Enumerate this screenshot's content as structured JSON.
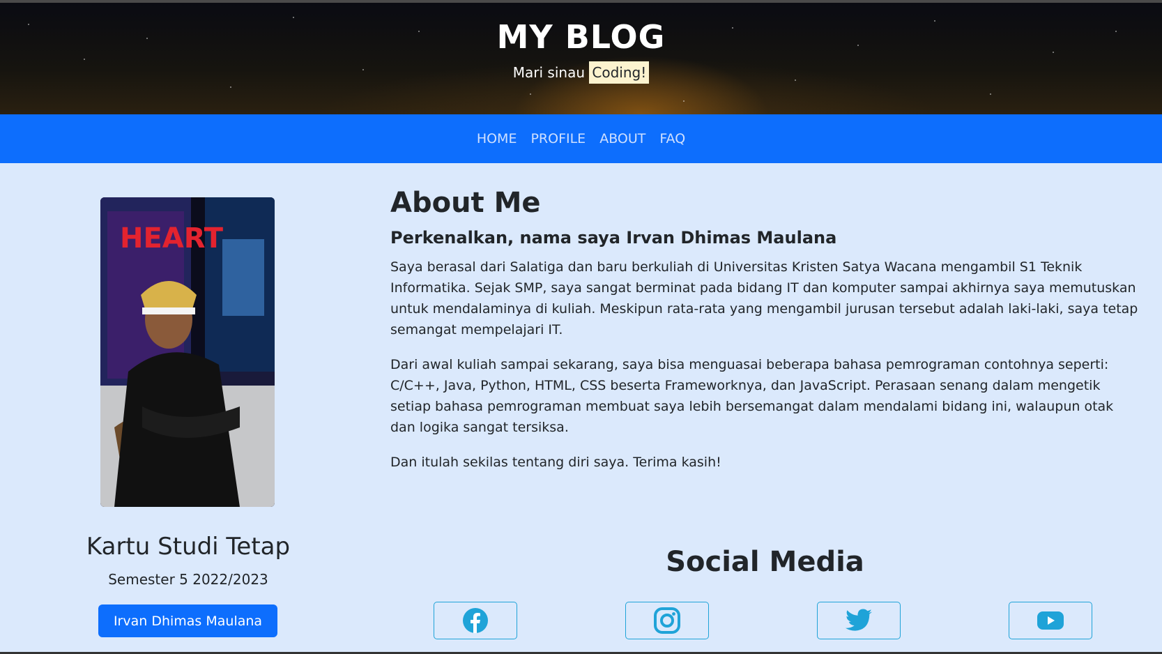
{
  "header": {
    "title": "MY BLOG",
    "tagline_prefix": "Mari sinau",
    "tagline_highlight": "Coding!"
  },
  "nav": {
    "items": [
      "HOME",
      "PROFILE",
      "ABOUT",
      "FAQ"
    ]
  },
  "profile": {
    "card_title": "Kartu Studi Tetap",
    "card_subtitle": "Semester 5 2022/2023",
    "name_button": "Irvan Dhimas Maulana",
    "photo_banner_text": "HEART"
  },
  "about": {
    "heading": "About Me",
    "subheading": "Perkenalkan, nama saya Irvan Dhimas Maulana",
    "paragraphs": [
      "Saya berasal dari Salatiga dan baru berkuliah di Universitas Kristen Satya Wacana mengambil S1 Teknik Informatika. Sejak SMP, saya sangat berminat pada bidang IT dan komputer sampai akhirnya saya memutuskan untuk mendalaminya di kuliah. Meskipun rata-rata yang mengambil jurusan tersebut adalah laki-laki, saya tetap semangat mempelajari IT.",
      "Dari awal kuliah sampai sekarang, saya bisa menguasai beberapa bahasa pemrograman contohnya seperti: C/C++, Java, Python, HTML, CSS beserta Frameworknya, dan JavaScript. Perasaan senang dalam mengetik setiap bahasa pemrograman membuat saya lebih bersemangat dalam mendalami bidang ini, walaupun otak dan logika sangat tersiksa.",
      "Dan itulah sekilas tentang diri saya. Terima kasih!"
    ]
  },
  "social": {
    "heading": "Social Media",
    "icons": [
      "facebook-icon",
      "instagram-icon",
      "twitter-icon",
      "youtube-icon"
    ],
    "icon_color": "#1fa3d8"
  },
  "colors": {
    "nav_bg": "#0d6efd",
    "page_bg": "#dbe9fc",
    "highlight_bg": "#fcf3cf"
  }
}
